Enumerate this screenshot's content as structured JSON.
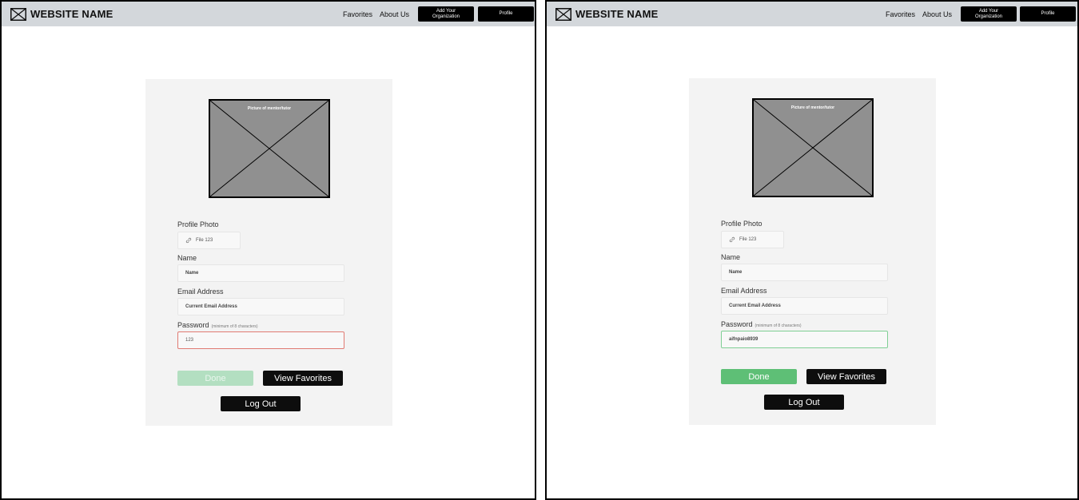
{
  "header": {
    "site_name": "WEBSITE NAME",
    "nav_favorites": "Favorites",
    "nav_about": "About Us",
    "add_org_line1": "Add Your",
    "add_org_line2": "Organization",
    "profile_label": "Profile"
  },
  "photo": {
    "label": "Picture of mentor/tutor"
  },
  "form": {
    "profile_photo_label": "Profile Photo",
    "file_value": "File 123",
    "name_label": "Name",
    "name_value": "Name",
    "email_label": "Email Address",
    "email_value": "Current Email Address",
    "password_label": "Password",
    "password_hint": "(minimum of 8 characters)"
  },
  "left_state": {
    "password_value": "123"
  },
  "right_state": {
    "password_value": "aifnpaio8939"
  },
  "buttons": {
    "done": "Done",
    "view_favorites": "View Favorites",
    "log_out": "Log Out"
  },
  "colors": {
    "done_disabled": "#b3dfc1",
    "done_active": "#5ebf76",
    "error_border": "#e07b73",
    "valid_border": "#7fcf94"
  }
}
